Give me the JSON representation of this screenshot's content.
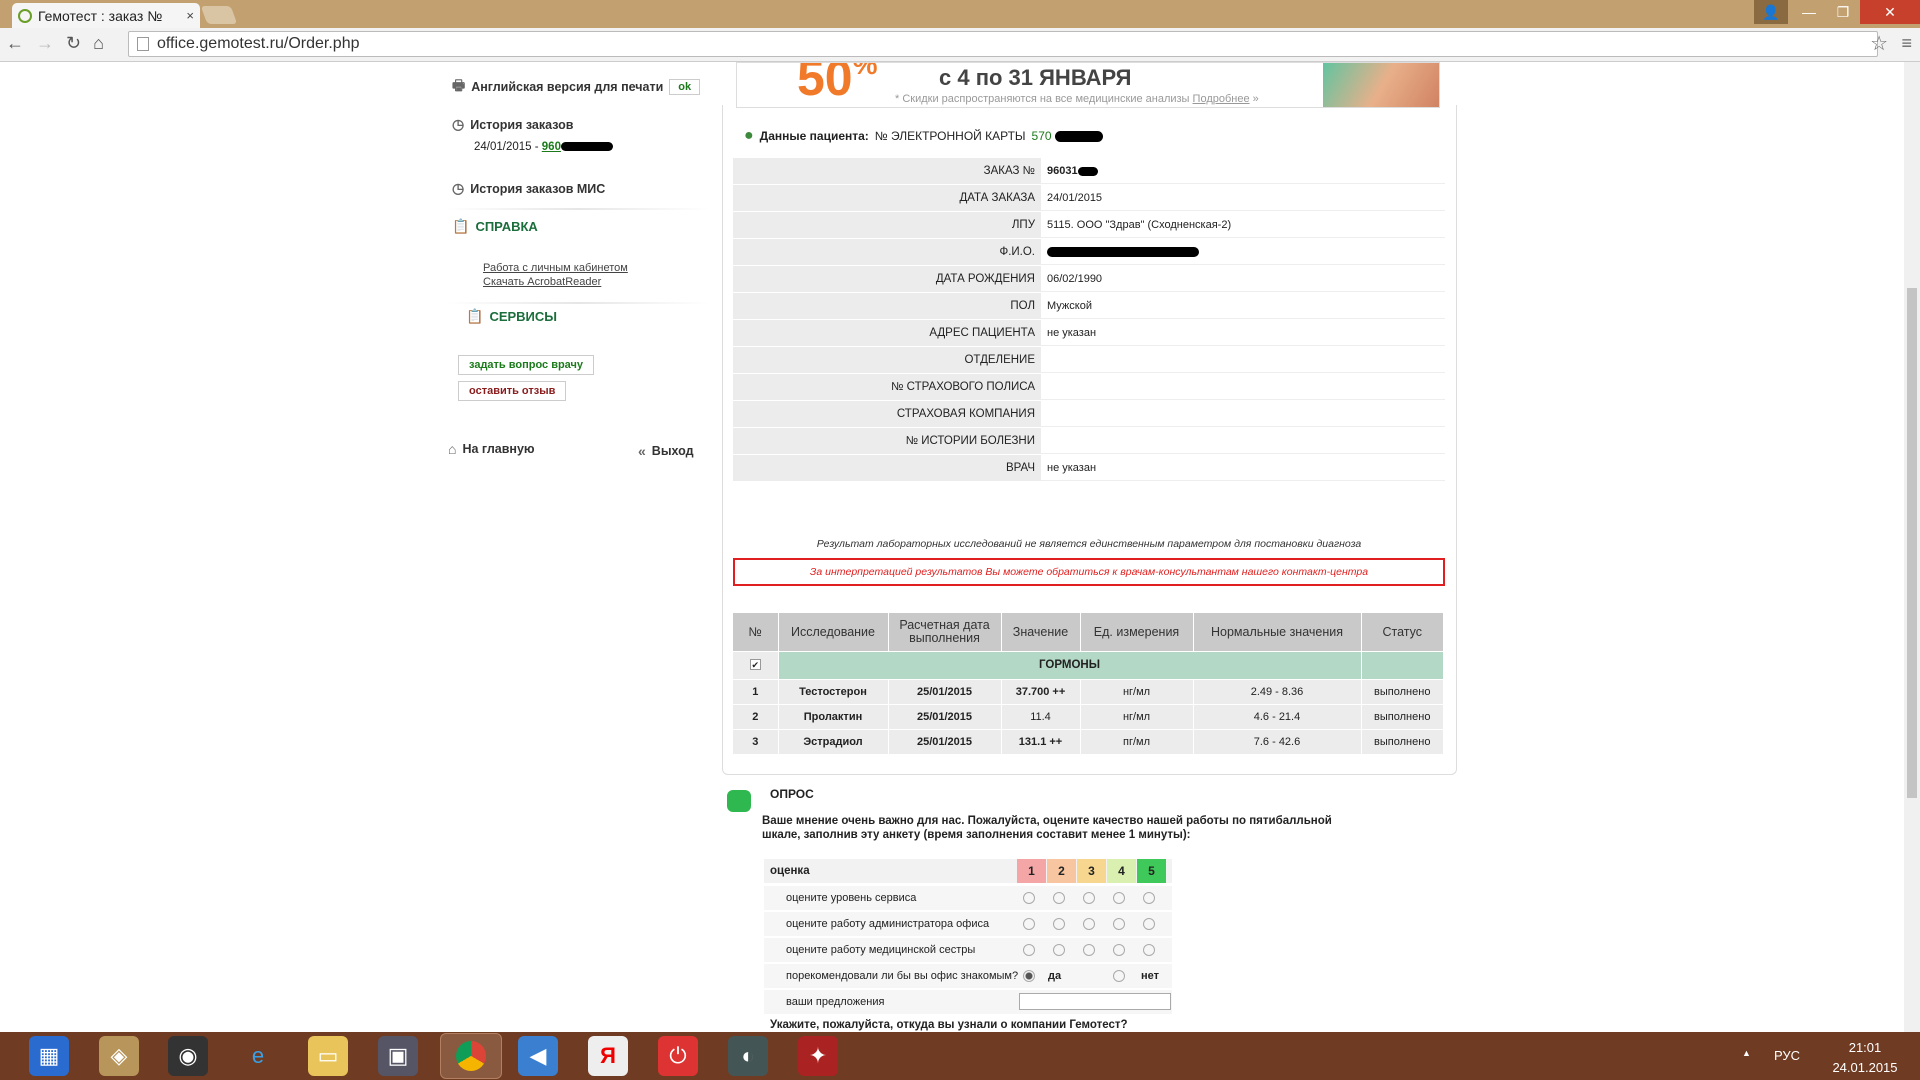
{
  "browser": {
    "tab_title": "Гемотест : заказ №",
    "tab_close": "×",
    "url": "office.gemotest.ru/Order.php",
    "window_buttons": [
      "minimize",
      "maximize",
      "close"
    ]
  },
  "banner": {
    "percent": "50",
    "percent_sign": "%",
    "dates": "с 4 по 31 ЯНВАРЯ",
    "note": "* Скидки распространяются на все медицинские анализы",
    "more_link": "Подробнее",
    "more_arrow": "»"
  },
  "sidebar": {
    "print_english": "Английская версия для печати",
    "ok": "ok",
    "history_title": "История заказов",
    "history_entry_date": "24/01/2015 - ",
    "history_entry_num": "960",
    "history_mis": "История заказов МИС",
    "help_title": "СПРАВКА",
    "help_links": [
      "Работа с личным кабинетом",
      "Скачать AcrobatReader"
    ],
    "services_title": "СЕРВИСЫ",
    "ask_doctor": "задать вопрос врачу",
    "leave_review": "оставить отзыв",
    "home": "На главную",
    "logout": "Выход"
  },
  "patient": {
    "heading": "Данные пациента:",
    "card_label": "№ ЭЛЕКТРОННОЙ КАРТЫ",
    "card_num": "570",
    "fields": [
      {
        "label": "ЗАКАЗ №",
        "value": "96031"
      },
      {
        "label": "ДАТА ЗАКАЗА",
        "value": "24/01/2015"
      },
      {
        "label": "ЛПУ",
        "value": "5115. ООО \"Здрав\" (Сходненская-2)"
      },
      {
        "label": "Ф.И.О.",
        "value": ""
      },
      {
        "label": "ДАТА РОЖДЕНИЯ",
        "value": "06/02/1990"
      },
      {
        "label": "ПОЛ",
        "value": "Мужской"
      },
      {
        "label": "АДРЕС ПАЦИЕНТА",
        "value": "не указан"
      },
      {
        "label": "ОТДЕЛЕНИЕ",
        "value": ""
      },
      {
        "label": "№ СТРАХОВОГО ПОЛИСА",
        "value": ""
      },
      {
        "label": "СТРАХОВАЯ КОМПАНИЯ",
        "value": ""
      },
      {
        "label": "№ ИСТОРИИ БОЛЕЗНИ",
        "value": ""
      },
      {
        "label": "ВРАЧ",
        "value": "не указан"
      }
    ]
  },
  "disclaimer": "Результат лабораторных исследований не является единственным параметром для постановки диагноза",
  "notice": "За интерпретацией результатов Вы можете обратиться к врачам-консультантам нашего контакт-центра",
  "results": {
    "headers": [
      "№",
      "Исследование",
      "Расчетная дата выполнения",
      "Значение",
      "Ед. измерения",
      "Нормальные значения",
      "Статус"
    ],
    "group": "ГОРМОНЫ",
    "check": "✔",
    "rows": [
      [
        "1",
        "Тестостерон",
        "25/01/2015",
        "37.700 ++",
        "нг/мл",
        "2.49 - 8.36",
        "выполнено"
      ],
      [
        "2",
        "Пролактин",
        "25/01/2015",
        "11.4",
        "нг/мл",
        "4.6 - 21.4",
        "выполнено"
      ],
      [
        "3",
        "Эстрадиол",
        "25/01/2015",
        "131.1 ++",
        "пг/мл",
        "7.6 - 42.6",
        "выполнено"
      ]
    ]
  },
  "survey": {
    "title": "ОПРОС",
    "intro_line1": "Ваше мнение очень важно для нас. Пожалуйста, оцените качество нашей работы по пятибалльной",
    "intro_line2": "шкале, заполнив эту анкету (время заполнения составит менее 1 минуты):",
    "grade_label": "оценка",
    "grades": [
      "1",
      "2",
      "3",
      "4",
      "5"
    ],
    "grade_colors": [
      "#f4a6a6",
      "#f7c5a0",
      "#f7d78f",
      "#d9f0b0",
      "#3fc95a"
    ],
    "questions": [
      "оцените уровень сервиса",
      "оцените работу администратора офиса",
      "оцените работу медицинской сестры"
    ],
    "recommend_q": "порекомендовали ли бы вы офис знакомым?",
    "yes": "да",
    "no": "нет",
    "suggestions": "ваши предложения",
    "source_q": "Укажите, пожалуйста, откуда вы узнали о компании Гемотест?"
  },
  "taskbar": {
    "lang": "РУС",
    "time": "21:01",
    "date": "24.01.2015",
    "tray_arrow": "▲"
  }
}
